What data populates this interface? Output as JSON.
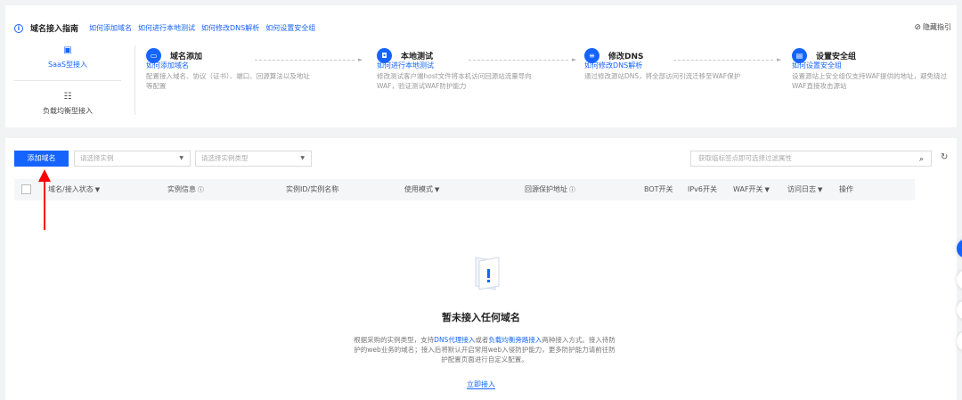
{
  "guide": {
    "title": "域名接入指南",
    "links": [
      "如何添加域名",
      "如何进行本地测试",
      "如何修改DNS解析",
      "如何设置安全组"
    ],
    "hide_label": "隐藏指引",
    "tabs": [
      {
        "label": "SaaS型接入",
        "active": true
      },
      {
        "label": "负载均衡型接入",
        "active": false
      }
    ],
    "steps": [
      {
        "title": "域名添加",
        "desc": "配置接入域名、协议（证书）、端口、回源算法以及地址等配置",
        "link": "如何添加域名"
      },
      {
        "title": "本地测试",
        "desc": "修改测试客户端host文件将本机访问回源站流量导向WAF，验证测试WAF防护能力",
        "link": "如何进行本地测试"
      },
      {
        "title": "修改DNS",
        "desc": "通过修改源站DNS，将全部访问引流迁移至WAF保护",
        "link": "如何修改DNS解析"
      },
      {
        "title": "设置安全组",
        "desc": "设置源站上安全组仅支持WAF提供的地址，避免绕过WAF直接攻击源站",
        "link": "如何设置安全组"
      }
    ]
  },
  "toolbar": {
    "add_label": "添加域名",
    "instance_placeholder": "请选择实例",
    "type_placeholder": "请选择实例类型",
    "search_placeholder": "获取临标签点即可选择过滤属性"
  },
  "table": {
    "columns": [
      "域名/接入状态",
      "实例信息",
      "实例ID/实例名称",
      "使用模式",
      "回源保护地址",
      "BOT开关",
      "IPv6开关",
      "WAF开关",
      "访问日志",
      "操作"
    ]
  },
  "empty": {
    "title": "暂未接入任何域名",
    "desc_1": "根据采购的实例类型，支持",
    "link_a": "DNS代理接入",
    "desc_2": "或者",
    "link_b": "负载均衡旁路接入",
    "desc_3": "两种接入方式。接入待防护的web业务的域名；接入后将默认开启常用web入侵防护能力，更多防护能力请前往防护配置页面进行自定义配置。",
    "action": "立即接入"
  },
  "colors": {
    "accent": "#1664ff",
    "arrow": "#ff0000"
  }
}
